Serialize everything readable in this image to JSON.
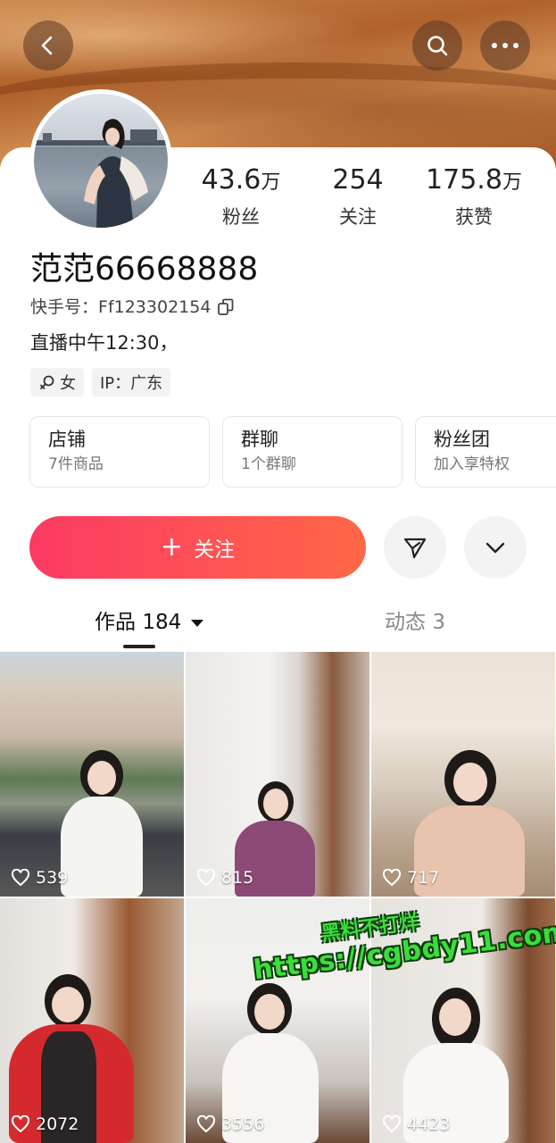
{
  "profile": {
    "name": "范范66668888",
    "kuaishou_id_label": "快手号：",
    "kuaishou_id": "Ff123302154",
    "bio": "直播中午12:30，",
    "gender_tag": "女",
    "gender_icon": "female-symbol",
    "ip_tag": "IP：广东"
  },
  "stats": [
    {
      "num": "43.6",
      "unit": "万",
      "label": "粉丝"
    },
    {
      "num": "254",
      "unit": "",
      "label": "关注"
    },
    {
      "num": "175.8",
      "unit": "万",
      "label": "获赞"
    }
  ],
  "entries": [
    {
      "title": "店铺",
      "sub": "7件商品"
    },
    {
      "title": "群聊",
      "sub": "1个群聊"
    },
    {
      "title": "粉丝团",
      "sub": "加入享特权"
    }
  ],
  "actions": {
    "follow_label": "关注",
    "follow_plus": "+"
  },
  "tabs": {
    "works_label": "作品",
    "works_count": "184",
    "dynamic_label": "动态",
    "dynamic_count": "3"
  },
  "videos": [
    {
      "likes": "539"
    },
    {
      "likes": "815"
    },
    {
      "likes": "717"
    },
    {
      "likes": "2072"
    },
    {
      "likes": "3556"
    },
    {
      "likes": "4423"
    }
  ],
  "watermark": {
    "line1": "黑料不打烊",
    "line2": "https://cgbdy11.com"
  },
  "colors": {
    "follow_gradient_start": "#fb3a63",
    "follow_gradient_end": "#ff6745",
    "watermark": "#3cdc3c"
  }
}
